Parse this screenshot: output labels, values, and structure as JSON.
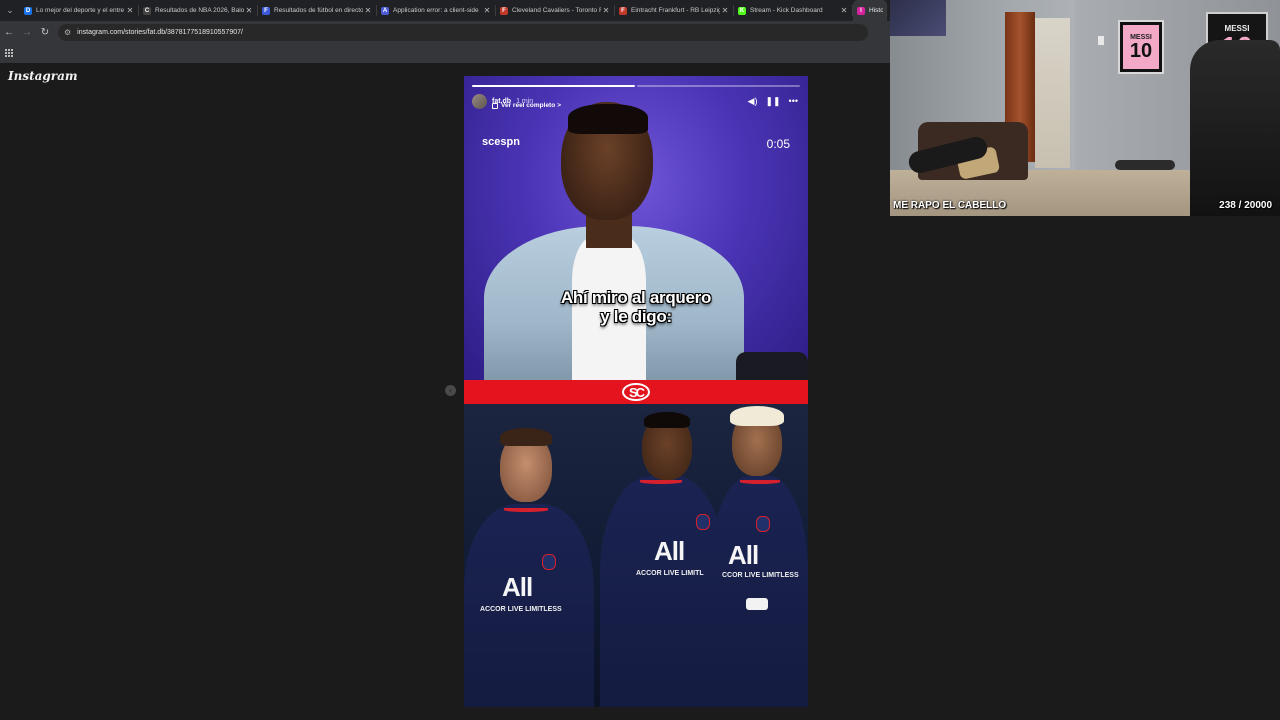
{
  "browser": {
    "tabs": [
      {
        "title": "Lo mejor del deporte y el entre",
        "favicon": "D",
        "favicon_color": "#1a73e8"
      },
      {
        "title": "Resultados de NBA 2026, Balon",
        "favicon": "C",
        "favicon_color": "#444444"
      },
      {
        "title": "Resultados de fútbol en directo",
        "favicon": "F",
        "favicon_color": "#3b5bdb"
      },
      {
        "title": "Application error: a client-side",
        "favicon": "A",
        "favicon_color": "#4c5bd4"
      },
      {
        "title": "Cleveland Cavaliers - Toronto R",
        "favicon": "F",
        "favicon_color": "#c0392b"
      },
      {
        "title": "Eintracht Frankfurt - RB Leipzig",
        "favicon": "F",
        "favicon_color": "#c0392b"
      },
      {
        "title": "Stream - Kick Dashboard",
        "favicon": "K",
        "favicon_color": "#53fc18"
      },
      {
        "title": "Historia",
        "favicon": "I",
        "favicon_color": "#d6249f",
        "active": true
      }
    ],
    "url": "instagram.com/stories/fat.db/3878177518910557907/"
  },
  "instagram": {
    "logo": "Instagram",
    "story": {
      "author": "fat.db",
      "time_ago": "1 min",
      "reel_link": "Ver reel completo",
      "reel_chevron": ">",
      "watermark": "scespn",
      "timer": "0:05",
      "caption_line1": "Ahí miro al arquero",
      "caption_line2": "y le digo:",
      "band_logo": "SC",
      "progress_segments": 2,
      "progress_current": 1,
      "controls": {
        "volume_icon": "speaker-icon",
        "pause_icon": "pause-icon",
        "more_icon": "more-icon"
      },
      "players": [
        {
          "all": "All",
          "accor": "ACCOR LIVE LIMITLESS"
        },
        {
          "all": "All",
          "accor": "ACCOR LIVE LIMITL"
        },
        {
          "all": "All",
          "accor": "CCOR LIVE LIMITLESS"
        }
      ]
    }
  },
  "webcam": {
    "title": "ME RAPO EL CABELLO",
    "counter": "238 / 20000",
    "frame_label": "MESSI",
    "frame_number": "10",
    "frame2_label": "MESSI",
    "frame2_number": "10"
  },
  "colors": {
    "story_purple": "#4b34b5",
    "sc_red": "#e3141e",
    "page_bg": "#1b1b1b",
    "psg_navy": "#1a2352"
  }
}
